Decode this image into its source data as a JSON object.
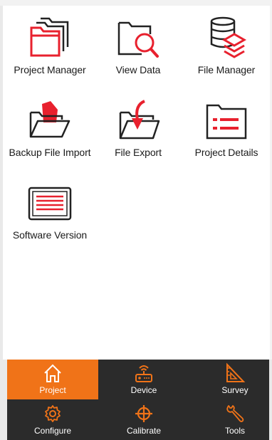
{
  "grid": {
    "items": [
      {
        "label": "Project Manager",
        "icon": "folder-stack-icon"
      },
      {
        "label": "View Data",
        "icon": "folder-search-icon"
      },
      {
        "label": "File Manager",
        "icon": "database-layers-icon"
      },
      {
        "label": "Backup File Import",
        "icon": "folder-import-icon"
      },
      {
        "label": "File Export",
        "icon": "folder-export-icon"
      },
      {
        "label": "Project Details",
        "icon": "folder-list-icon"
      },
      {
        "label": "Software Version",
        "icon": "monitor-lines-icon"
      }
    ]
  },
  "bottom_nav": {
    "items": [
      {
        "label": "Project",
        "icon": "home-icon",
        "active": true
      },
      {
        "label": "Device",
        "icon": "router-icon",
        "active": false
      },
      {
        "label": "Survey",
        "icon": "triangle-ruler-icon",
        "active": false
      },
      {
        "label": "Configure",
        "icon": "gear-icon",
        "active": false
      },
      {
        "label": "Calibrate",
        "icon": "crosshair-icon",
        "active": false
      },
      {
        "label": "Tools",
        "icon": "wrench-icon",
        "active": false
      }
    ]
  },
  "colors": {
    "accent": "#f07318",
    "icon_red": "#e8212e",
    "nav_bg": "#2b2b2b"
  }
}
